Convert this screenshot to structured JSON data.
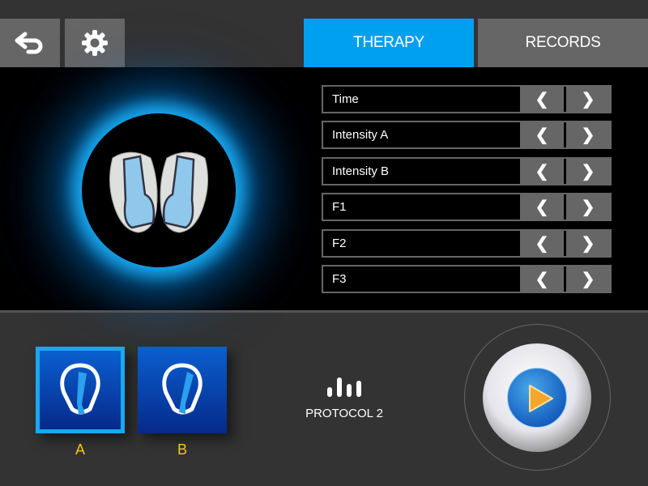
{
  "header": {
    "back_icon": "undo-arrow-icon",
    "settings_icon": "gear-icon",
    "tabs": [
      {
        "label": "THERAPY",
        "active": true
      },
      {
        "label": "RECORDS",
        "active": false
      }
    ],
    "accent": "#00a0f0"
  },
  "parameters": [
    {
      "label": "Time"
    },
    {
      "label": "Intensity A"
    },
    {
      "label": "Intensity B"
    },
    {
      "label": "F1"
    },
    {
      "label": "F2"
    },
    {
      "label": "F3"
    }
  ],
  "arrows": {
    "left": "❮",
    "right": "❯"
  },
  "channels": [
    {
      "label": "A",
      "selected": true
    },
    {
      "label": "B",
      "selected": false
    }
  ],
  "protocol": {
    "label": "PROTOCOL 2",
    "icon": "bars-icon"
  },
  "play_icon": "play-icon",
  "image": "electrode-pads-image"
}
